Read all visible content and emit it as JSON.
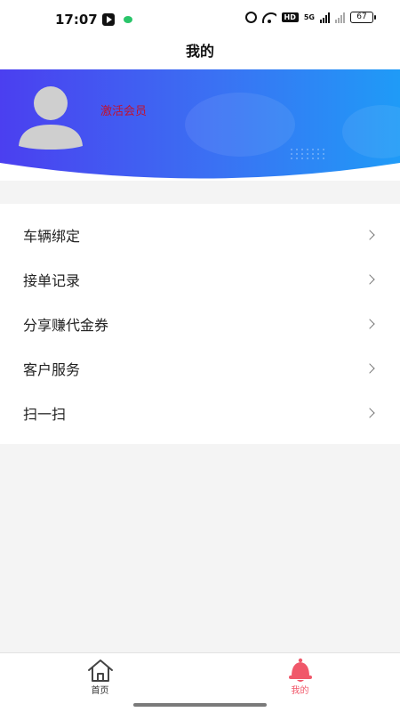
{
  "status_bar": {
    "time": "17:07",
    "battery": "67",
    "network": "5G",
    "hd": "HD"
  },
  "page": {
    "title": "我的"
  },
  "profile": {
    "activate_label": "激活会员"
  },
  "colors": {
    "banner_left": "#4b3ff0",
    "banner_right": "#1f9bf7",
    "activate_text": "#c1122f",
    "active_tab": "#f0586a",
    "background": "#f4f4f4"
  },
  "menu": {
    "items": [
      {
        "label": "车辆绑定",
        "icon": "chevron-right-icon"
      },
      {
        "label": "接单记录",
        "icon": "chevron-right-icon"
      },
      {
        "label": "分享赚代金券",
        "icon": "chevron-right-icon"
      },
      {
        "label": "客户服务",
        "icon": "chevron-right-icon"
      },
      {
        "label": "扫一扫",
        "icon": "chevron-right-icon"
      }
    ]
  },
  "bottom_nav": {
    "tabs": [
      {
        "label": "首页",
        "icon": "home-icon",
        "active": false
      },
      {
        "label": "我的",
        "icon": "bell-icon",
        "active": true
      }
    ]
  }
}
